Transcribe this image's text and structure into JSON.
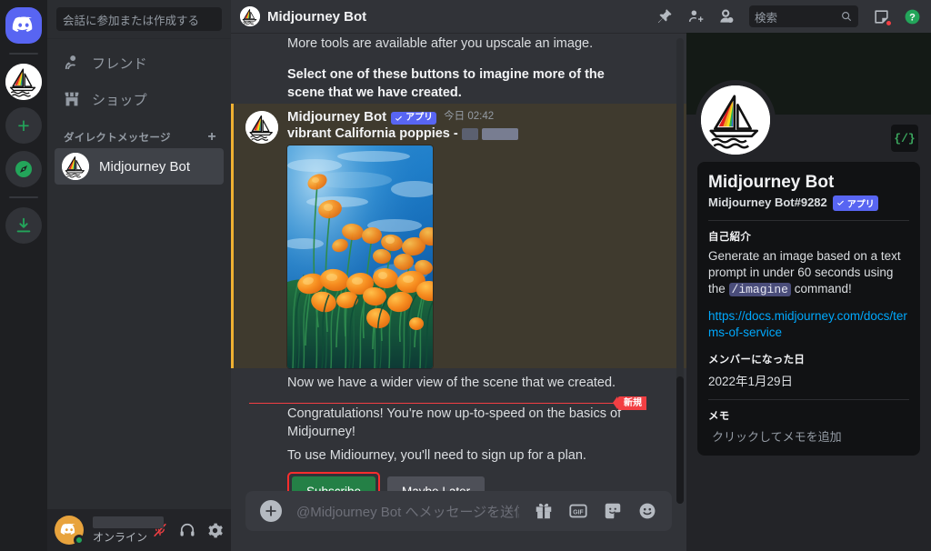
{
  "rail": {
    "items": [
      {
        "name": "discord-home",
        "icon": "discord-logo"
      },
      {
        "name": "midjourney-dm",
        "icon": "midjourney-sailboat"
      },
      {
        "name": "add-server",
        "icon": "plus"
      },
      {
        "name": "explore-servers",
        "icon": "compass"
      },
      {
        "name": "download-apps",
        "icon": "download-arrow"
      }
    ]
  },
  "sidebar": {
    "search_placeholder": "会話に参加または作成する",
    "nav": [
      {
        "label": "フレンド",
        "icon": "friends-icon"
      },
      {
        "label": "ショップ",
        "icon": "shop-icon"
      }
    ],
    "dm_header": "ダイレクトメッセージ",
    "dm_add_label": "+",
    "dms": [
      {
        "label": "Midjourney Bot",
        "active": true
      }
    ],
    "user": {
      "status": "オンライン",
      "mic_icon": "mic-muted-icon",
      "headset_icon": "headset-icon",
      "settings_icon": "gear-icon"
    }
  },
  "topbar": {
    "title": "Midjourney Bot",
    "avatar_icon": "midjourney-sailboat",
    "icons": [
      "pin-icon",
      "add-friend-icon",
      "member-list-icon"
    ],
    "search_placeholder": "検索",
    "inbox_icon": "inbox-icon",
    "help_icon": "help-icon"
  },
  "chat": {
    "pre_messages": [
      {
        "text": "More tools are available after you upscale an image.",
        "bold": false
      },
      {
        "text": "Select one of these buttons to imagine more of the scene that we have created.",
        "bold": true
      }
    ],
    "message": {
      "author": "Midjourney Bot",
      "app_tag": "アプリ",
      "timestamp_day": "今日",
      "timestamp_time": "02:42",
      "prompt": "vibrant California poppies -",
      "image_alt": "vibrant California poppies painting"
    },
    "post_messages": [
      "Now we have a wider view of the scene that we created."
    ],
    "new_divider_label": "新規",
    "after_divider": [
      "Congratulations! You're now up-to-speed on the basics of Midjourney!",
      "To use Midiourney, you'll need to sign up for a plan."
    ],
    "buttons": [
      {
        "label": "Subscribe",
        "style": "green",
        "highlighted": true
      },
      {
        "label": "Maybe Later",
        "style": "grey",
        "highlighted": false
      }
    ],
    "composer": {
      "placeholder": "@Midjourney Bot へメッセージを送信",
      "plus_icon": "add-attachment-icon",
      "icons": [
        "gift-icon",
        "gif-icon",
        "sticker-icon",
        "emoji-icon"
      ]
    }
  },
  "profile": {
    "banner_color": "#141a16",
    "code_badge": "{/}",
    "name": "Midjourney Bot",
    "handle": "Midjourney Bot#9282",
    "app_tag": "アプリ",
    "bio_title": "自己紹介",
    "bio_text_before": "Generate an image based on a text prompt in under 60 seconds using the ",
    "bio_code": "/imagine",
    "bio_text_after": " command!",
    "link": "https://docs.midjourney.com/docs/terms-of-service",
    "member_since_title": "メンバーになった日",
    "member_since_value": "2022年1月29日",
    "note_title": "メモ",
    "note_placeholder": "クリックしてメモを追加"
  },
  "colors": {
    "brand": "#5865f2",
    "green_button": "#248046",
    "highlight_red": "#ff2d2d",
    "new_divider": "#f23f43",
    "mention_bg": "#3f3a2e",
    "mention_bar": "#f0b132",
    "online": "#23a55a",
    "link": "#00a8fc"
  }
}
